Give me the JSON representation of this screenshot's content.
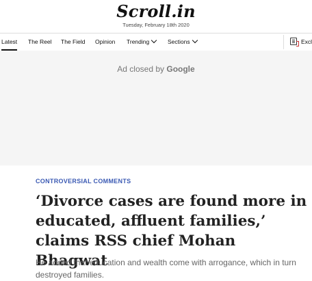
{
  "site": {
    "logo": "Scroll.in",
    "date": "Tuesday, February 18th 2020"
  },
  "nav": {
    "items": [
      {
        "label": "Latest"
      },
      {
        "label": "The Reel"
      },
      {
        "label": "The Field"
      },
      {
        "label": "Opinion"
      },
      {
        "label": "Trending",
        "dropdown": true
      },
      {
        "label": "Sections",
        "dropdown": true
      }
    ],
    "exclusive_label": "Excl",
    "exclusive_icon": "newspaper-icon"
  },
  "ad": {
    "text": "Ad closed by",
    "brand": "Google"
  },
  "article": {
    "kicker": "CONTROVERSIAL COMMENTS",
    "headline": "‘Divorce cases are found more in educated, affluent families,’ claims RSS chief Mohan Bhagwat",
    "dek": "He added that education and wealth come with arrogance, which in turn destroyed families."
  },
  "colors": {
    "accent": "#3a59b3",
    "ad_background": "#f5f5f5"
  }
}
